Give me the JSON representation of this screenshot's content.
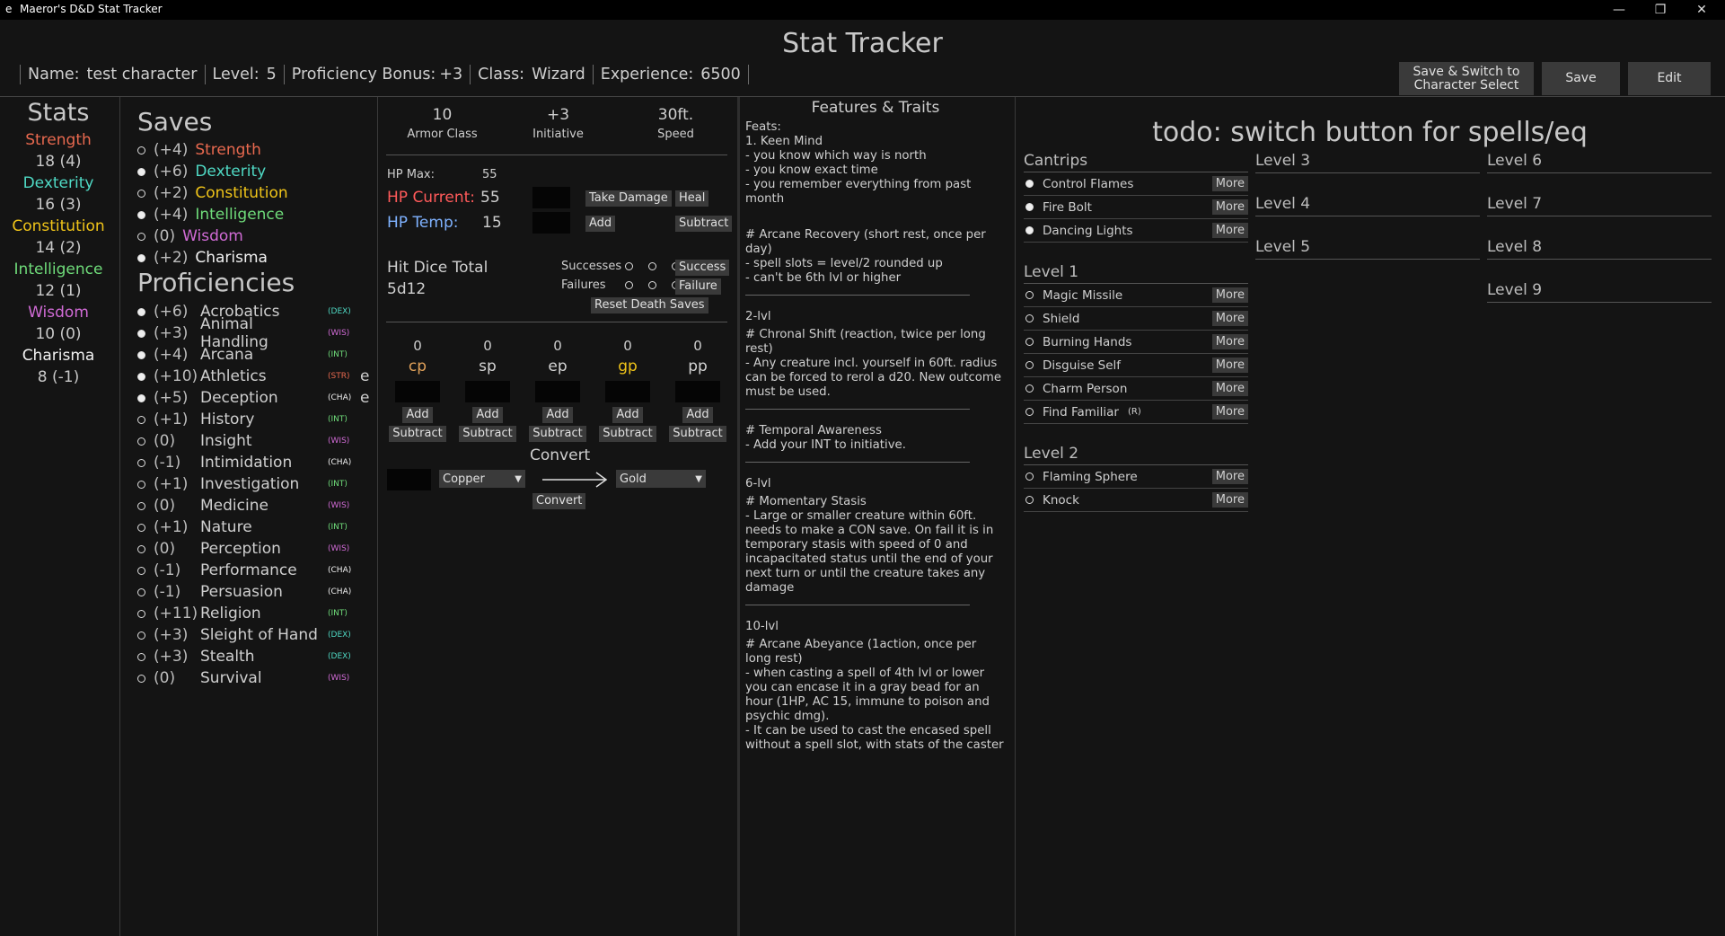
{
  "window": {
    "title": "Maeror's D&D Stat Tracker",
    "icon": "e",
    "controls": [
      "—",
      "❐",
      "✕"
    ]
  },
  "app_title": "Stat Tracker",
  "info": {
    "name_label": "Name:",
    "name": "test character",
    "level_label": "Level:",
    "level": "5",
    "prof_label": "Proficiency Bonus:",
    "prof": "+3",
    "class_label": "Class:",
    "class": "Wizard",
    "xp_label": "Experience:",
    "xp": "6500"
  },
  "buttons": {
    "switch": "Save & Switch to Character Select",
    "save": "Save",
    "edit": "Edit"
  },
  "stats": {
    "header": "Stats",
    "items": [
      {
        "name": "Strength",
        "value": "18 (4)",
        "color": "#e8694f"
      },
      {
        "name": "Dexterity",
        "value": "16 (3)",
        "color": "#4fd9c4"
      },
      {
        "name": "Constitution",
        "value": "14 (2)",
        "color": "#f0c419"
      },
      {
        "name": "Intelligence",
        "value": "12 (1)",
        "color": "#6fdc7a"
      },
      {
        "name": "Wisdom",
        "value": "10 (0)",
        "color": "#d16bd6"
      },
      {
        "name": "Charisma",
        "value": "8 (-1)",
        "color": "#f2f2f2"
      }
    ]
  },
  "saves": {
    "header": "Saves",
    "items": [
      {
        "bonus": "(+4)",
        "name": "Strength",
        "prof": false,
        "color": "#e8694f"
      },
      {
        "bonus": "(+6)",
        "name": "Dexterity",
        "prof": true,
        "color": "#4fd9c4"
      },
      {
        "bonus": "(+2)",
        "name": "Constitution",
        "prof": false,
        "color": "#f0c419"
      },
      {
        "bonus": "(+4)",
        "name": "Intelligence",
        "prof": true,
        "color": "#6fdc7a"
      },
      {
        "bonus": "(0)",
        "name": "Wisdom",
        "prof": false,
        "color": "#d16bd6"
      },
      {
        "bonus": "(+2)",
        "name": "Charisma",
        "prof": true,
        "color": "#f2f2f2"
      }
    ]
  },
  "proficiencies": {
    "header": "Proficiencies",
    "items": [
      {
        "bonus": "(+6)",
        "name": "Acrobatics",
        "abbr": "(DEX)",
        "prof": true,
        "expert": ""
      },
      {
        "bonus": "(+3)",
        "name": "Animal Handling",
        "abbr": "(WIS)",
        "prof": true,
        "expert": ""
      },
      {
        "bonus": "(+4)",
        "name": "Arcana",
        "abbr": "(INT)",
        "prof": true,
        "expert": ""
      },
      {
        "bonus": "(+10)",
        "name": "Athletics",
        "abbr": "(STR)",
        "prof": true,
        "expert": "e"
      },
      {
        "bonus": "(+5)",
        "name": "Deception",
        "abbr": "(CHA)",
        "prof": true,
        "expert": "e"
      },
      {
        "bonus": "(+1)",
        "name": "History",
        "abbr": "(INT)",
        "prof": false,
        "expert": ""
      },
      {
        "bonus": "(0)",
        "name": "Insight",
        "abbr": "(WIS)",
        "prof": false,
        "expert": ""
      },
      {
        "bonus": "(-1)",
        "name": "Intimidation",
        "abbr": "(CHA)",
        "prof": false,
        "expert": ""
      },
      {
        "bonus": "(+1)",
        "name": "Investigation",
        "abbr": "(INT)",
        "prof": false,
        "expert": ""
      },
      {
        "bonus": "(0)",
        "name": "Medicine",
        "abbr": "(WIS)",
        "prof": false,
        "expert": ""
      },
      {
        "bonus": "(+1)",
        "name": "Nature",
        "abbr": "(INT)",
        "prof": false,
        "expert": ""
      },
      {
        "bonus": "(0)",
        "name": "Perception",
        "abbr": "(WIS)",
        "prof": false,
        "expert": ""
      },
      {
        "bonus": "(-1)",
        "name": "Performance",
        "abbr": "(CHA)",
        "prof": false,
        "expert": ""
      },
      {
        "bonus": "(-1)",
        "name": "Persuasion",
        "abbr": "(CHA)",
        "prof": false,
        "expert": ""
      },
      {
        "bonus": "(+11)",
        "name": "Religion",
        "abbr": "(INT)",
        "prof": false,
        "expert": ""
      },
      {
        "bonus": "(+3)",
        "name": "Sleight of Hand",
        "abbr": "(DEX)",
        "prof": false,
        "expert": ""
      },
      {
        "bonus": "(+3)",
        "name": "Stealth",
        "abbr": "(DEX)",
        "prof": false,
        "expert": ""
      },
      {
        "bonus": "(0)",
        "name": "Survival",
        "abbr": "(WIS)",
        "prof": false,
        "expert": ""
      }
    ]
  },
  "abbr_colors": {
    "(DEX)": "#4fd9c4",
    "(WIS)": "#d16bd6",
    "(INT)": "#6fdc7a",
    "(STR)": "#e8694f",
    "(CHA)": "#f2f2f2"
  },
  "combat": {
    "ac": "10",
    "ac_label": "Armor Class",
    "init": "+3",
    "init_label": "Initiative",
    "speed": "30ft.",
    "speed_label": "Speed"
  },
  "hp": {
    "max_label": "HP Max:",
    "max": "55",
    "current_label": "HP Current:",
    "current": "55",
    "temp_label": "HP Temp:",
    "temp": "15",
    "take_damage": "Take Damage",
    "heal": "Heal",
    "add": "Add",
    "subtract": "Subtract"
  },
  "hit_dice": {
    "label": "Hit Dice Total",
    "value": "5d12"
  },
  "death_saves": {
    "successes_label": "Successes",
    "failures_label": "Failures",
    "success_btn": "Success",
    "failure_btn": "Failure",
    "reset_btn": "Reset Death Saves"
  },
  "coins": [
    {
      "amount": "0",
      "name": "cp",
      "color": "#e0a15a"
    },
    {
      "amount": "0",
      "name": "sp",
      "color": "#d4d4d4"
    },
    {
      "amount": "0",
      "name": "ep",
      "color": "#d4d4d4"
    },
    {
      "amount": "0",
      "name": "gp",
      "color": "#f0c419"
    },
    {
      "amount": "0",
      "name": "pp",
      "color": "#d4d4d4"
    }
  ],
  "coin_buttons": {
    "add": "Add",
    "subtract": "Subtract"
  },
  "convert": {
    "label": "Convert",
    "from": "Copper",
    "to": "Gold",
    "button": "Convert"
  },
  "features": {
    "title": "Features & Traits",
    "feats_label": "Feats:",
    "feat1": [
      "1. Keen Mind",
      "- you know which way is north",
      "- you know exact time",
      "- you remember everything from past month"
    ],
    "block2": [
      "# Arcane Recovery (short rest, once per day)",
      "- spell slots = level/2 rounded up",
      "- can't be 6th lvl or higher"
    ],
    "block3": [
      "2-lvl",
      "# Chronal Shift (reaction, twice per long rest)",
      "- Any creature incl. yourself in 60ft. radius can be forced to rerol a d20. New outcome must be used."
    ],
    "block4": [
      "# Temporal Awareness",
      "- Add your INT to initiative."
    ],
    "block5": [
      "6-lvl",
      "# Momentary Stasis",
      "- Large or smaller creature within 60ft. needs to make a CON save. On fail it is in temporary stasis with speed of 0 and incapacitated status until the end of your next turn or until the creature takes any damage"
    ],
    "block6": [
      "10-lvl",
      "# Arcane Abeyance (1action, once per long rest)",
      "- when casting a spell of 4th lvl or lower you can encase it in a gray bead for an hour (1HP, AC 15, immune to poison and psychic dmg).",
      "- It can be used to cast the encased spell without a spell slot, with stats of the caster"
    ]
  },
  "spells": {
    "todo": "todo: switch button for spells/eq",
    "more_label": "More",
    "cantrips_label": "Cantrips",
    "cantrips": [
      {
        "name": "Control Flames",
        "prepared": true
      },
      {
        "name": "Fire Bolt",
        "prepared": true
      },
      {
        "name": "Dancing Lights",
        "prepared": true
      }
    ],
    "level1_label": "Level 1",
    "level1": [
      {
        "name": "Magic Missile",
        "prepared": false,
        "tag": ""
      },
      {
        "name": "Shield",
        "prepared": false,
        "tag": ""
      },
      {
        "name": "Burning Hands",
        "prepared": false,
        "tag": ""
      },
      {
        "name": "Disguise Self",
        "prepared": false,
        "tag": ""
      },
      {
        "name": "Charm Person",
        "prepared": false,
        "tag": ""
      },
      {
        "name": "Find Familiar",
        "prepared": false,
        "tag": "(R)"
      }
    ],
    "level2_label": "Level 2",
    "level2": [
      {
        "name": "Flaming Sphere",
        "prepared": false
      },
      {
        "name": "Knock",
        "prepared": false
      }
    ],
    "levels_mid": [
      "Level 3",
      "Level 4",
      "Level 5"
    ],
    "levels_right": [
      "Level 6",
      "Level 7",
      "Level 8",
      "Level 9"
    ]
  }
}
